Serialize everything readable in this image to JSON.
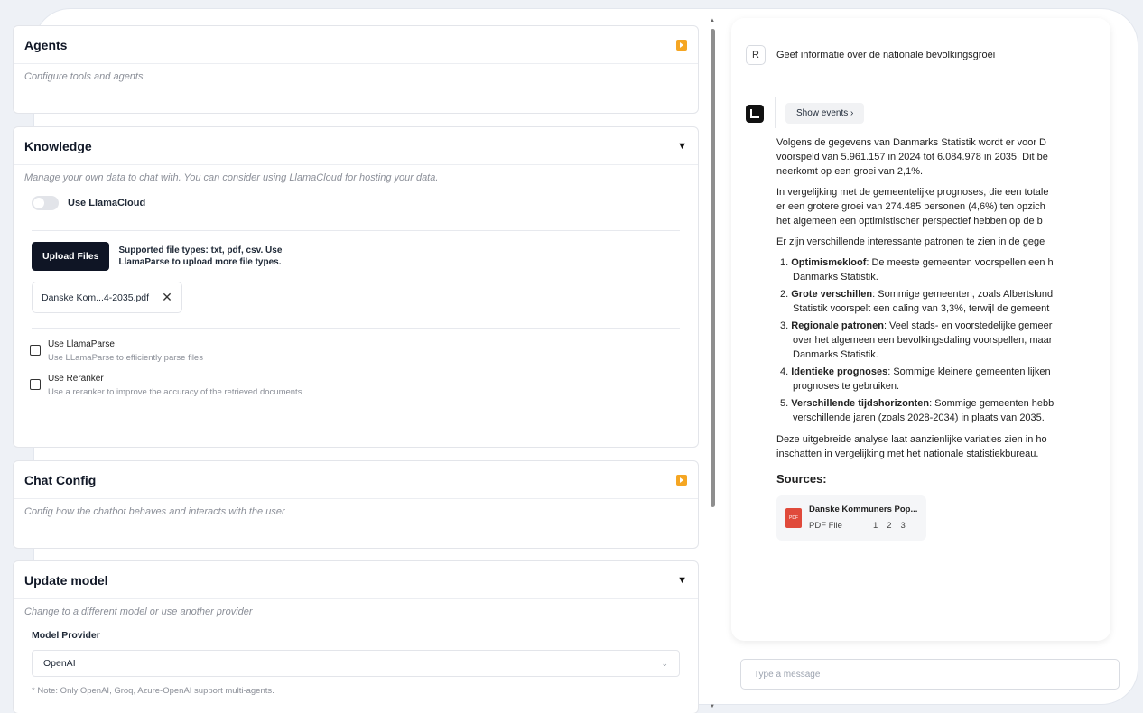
{
  "cards": {
    "agents": {
      "title": "Agents",
      "desc": "Configure tools and agents"
    },
    "knowledge": {
      "title": "Knowledge",
      "desc": "Manage your own data to chat with. You can consider using LlamaCloud for hosting your data.",
      "toggle_label": "Use LlamaCloud",
      "upload_label": "Upload Files",
      "upload_hint": "Supported file types: txt, pdf, csv. Use LlamaParse to upload more file types.",
      "file_name": "Danske Kom...4-2035.pdf",
      "checks": [
        {
          "title": "Use LlamaParse",
          "sub": "Use LLamaParse to efficiently parse files"
        },
        {
          "title": "Use Reranker",
          "sub": "Use a reranker to improve the accuracy of the retrieved documents"
        }
      ]
    },
    "chat_config": {
      "title": "Chat Config",
      "desc": "Config how the chatbot behaves and interacts with the user"
    },
    "update_model": {
      "title": "Update model",
      "desc": "Change to a different model or use another provider",
      "provider_label": "Model Provider",
      "provider_value": "OpenAI",
      "note": "* Note: Only OpenAI, Groq, Azure-OpenAI support multi-agents."
    }
  },
  "chat": {
    "user_avatar": "R",
    "user_message": "Geef informatie over de nationale bevolkingsgroei",
    "events_label": "Show events  ›",
    "paragraphs": [
      "Volgens de gegevens van Danmarks Statistik wordt er voor D",
      "voorspeld van 5.961.157 in 2024 tot 6.084.978 in 2035. Dit be",
      "neerkomt op een groei van 2,1%."
    ],
    "paragraphs2": [
      "In vergelijking met de gemeentelijke prognoses, die een totale",
      "er een grotere groei van 274.485 personen (4,6%) ten opzich",
      "het algemeen een optimistischer perspectief hebben op de b"
    ],
    "intro_list": "Er zijn verschillende interessante patronen te zien in de gege",
    "items": [
      {
        "num": "1.",
        "bold": "Optimismekloof",
        "text": ": De meeste gemeenten voorspellen een h",
        "cont": [
          "Danmarks Statistik."
        ]
      },
      {
        "num": "2.",
        "bold": "Grote verschillen",
        "text": ": Sommige gemeenten, zoals Albertslund",
        "cont": [
          "Statistik voorspelt een daling van 3,3%, terwijl de gemeent"
        ]
      },
      {
        "num": "3.",
        "bold": "Regionale patronen",
        "text": ": Veel stads- en voorstedelijke gemeer",
        "cont": [
          "over het algemeen een bevolkingsdaling voorspellen, maar",
          "Danmarks Statistik."
        ]
      },
      {
        "num": "4.",
        "bold": "Identieke prognoses",
        "text": ": Sommige kleinere gemeenten lijken",
        "cont": [
          "prognoses te gebruiken."
        ]
      },
      {
        "num": "5.",
        "bold": "Verschillende tijdshorizonten",
        "text": ": Sommige gemeenten hebb",
        "cont": [
          "verschillende jaren (zoals 2028-2034) in plaats van 2035."
        ]
      }
    ],
    "closing": [
      "Deze uitgebreide analyse laat aanzienlijke variaties zien in ho",
      "inschatten in vergelijking met het nationale statistiekbureau."
    ],
    "sources_title": "Sources:",
    "source": {
      "name": "Danske Kommuners Pop...",
      "type": "PDF File",
      "pages": [
        "1",
        "2",
        "3"
      ],
      "icon": "PDF"
    },
    "input_placeholder": "Type a message"
  }
}
